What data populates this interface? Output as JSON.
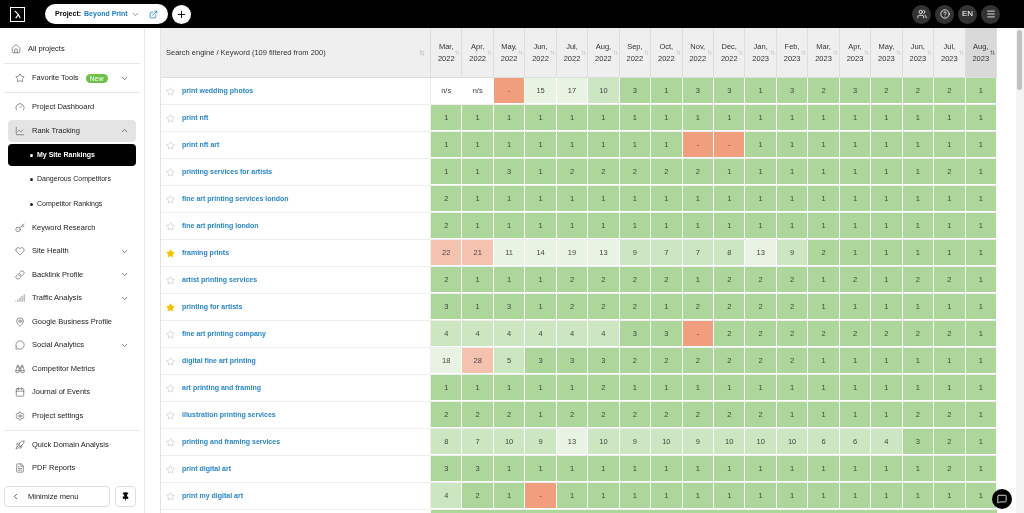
{
  "top_bar": {
    "project_label": "Project:",
    "project_name": "Beyond Print",
    "language": "EN"
  },
  "sidebar": {
    "groups": [
      [
        {
          "label": "All projects",
          "selected": false
        }
      ],
      [
        {
          "label": "Favorite Tools",
          "badge": "New",
          "expanded": false,
          "selected": false
        }
      ],
      [
        {
          "label": "Project Dashboard",
          "selected": false
        },
        {
          "label": "Rank Tracking",
          "expanded": true,
          "selected": true,
          "children": [
            {
              "label": "My Site Rankings",
              "selected": true
            },
            {
              "label": "Dangerous Competitors",
              "selected": false
            },
            {
              "label": "Competitor Rankings",
              "selected": false
            }
          ]
        },
        {
          "label": "Keyword Research",
          "selected": false
        },
        {
          "label": "Site Health",
          "expanded": false,
          "selected": false
        },
        {
          "label": "Backlink Profile",
          "expanded": false,
          "selected": false
        },
        {
          "label": "Traffic Analysis",
          "expanded": false,
          "selected": false
        },
        {
          "label": "Google Business Profile",
          "selected": false
        },
        {
          "label": "Social Analytics",
          "expanded": false,
          "selected": false
        },
        {
          "label": "Competitor Metrics",
          "selected": false
        },
        {
          "label": "Journal of Events",
          "selected": false
        },
        {
          "label": "Project settings",
          "selected": false
        }
      ],
      [
        {
          "label": "Quick Domain Analysis",
          "selected": false
        },
        {
          "label": "PDF Reports",
          "selected": false
        }
      ]
    ],
    "minimize": "Minimize menu"
  },
  "table": {
    "keyword_header": "Search engine / Keyword (109 filtered from 200)",
    "columns": [
      {
        "label": "Mar, 2022",
        "sorted": false
      },
      {
        "label": "Apr, 2022",
        "sorted": false
      },
      {
        "label": "May, 2022",
        "sorted": false
      },
      {
        "label": "Jun, 2022",
        "sorted": false
      },
      {
        "label": "Jul, 2022",
        "sorted": false
      },
      {
        "label": "Aug, 2022",
        "sorted": false
      },
      {
        "label": "Sep, 2022",
        "sorted": false
      },
      {
        "label": "Oct, 2022",
        "sorted": false
      },
      {
        "label": "Nov, 2022",
        "sorted": false
      },
      {
        "label": "Dec, 2022",
        "sorted": false
      },
      {
        "label": "Jan, 2023",
        "sorted": false
      },
      {
        "label": "Feb, 2023",
        "sorted": false
      },
      {
        "label": "Mar, 2023",
        "sorted": false
      },
      {
        "label": "Apr, 2023",
        "sorted": false
      },
      {
        "label": "May, 2023",
        "sorted": false
      },
      {
        "label": "Jun, 2023",
        "sorted": false
      },
      {
        "label": "Jul, 2023",
        "sorted": false
      },
      {
        "label": "Aug, 2023",
        "sorted": true
      }
    ],
    "rows": [
      {
        "keyword": "print wedding photos",
        "starred": false,
        "cells": [
          {
            "text": "n/s",
            "color": "#ffffff"
          },
          {
            "text": "n/s",
            "color": "#ffffff"
          },
          {
            "text": "-",
            "color": "#f19e7f"
          },
          {
            "text": "15",
            "color": "#e9f3e3"
          },
          {
            "text": "17",
            "color": "#e9f3e3"
          },
          {
            "text": "10",
            "color": "#cde6c2"
          },
          {
            "text": "3",
            "color": "#acd69a"
          },
          {
            "text": "1",
            "color": "#acd69a"
          },
          {
            "text": "3",
            "color": "#acd69a"
          },
          {
            "text": "3",
            "color": "#acd69a"
          },
          {
            "text": "1",
            "color": "#acd69a"
          },
          {
            "text": "3",
            "color": "#acd69a"
          },
          {
            "text": "2",
            "color": "#acd69a"
          },
          {
            "text": "3",
            "color": "#acd69a"
          },
          {
            "text": "2",
            "color": "#acd69a"
          },
          {
            "text": "2",
            "color": "#acd69a"
          },
          {
            "text": "2",
            "color": "#acd69a"
          },
          {
            "text": "1",
            "color": "#acd69a"
          }
        ]
      },
      {
        "keyword": "print nft",
        "starred": false,
        "cells": [
          {
            "text": "1",
            "color": "#acd69a"
          },
          {
            "text": "1",
            "color": "#acd69a"
          },
          {
            "text": "1",
            "color": "#acd69a"
          },
          {
            "text": "1",
            "color": "#acd69a"
          },
          {
            "text": "1",
            "color": "#acd69a"
          },
          {
            "text": "1",
            "color": "#acd69a"
          },
          {
            "text": "1",
            "color": "#acd69a"
          },
          {
            "text": "1",
            "color": "#acd69a"
          },
          {
            "text": "1",
            "color": "#acd69a"
          },
          {
            "text": "1",
            "color": "#acd69a"
          },
          {
            "text": "1",
            "color": "#acd69a"
          },
          {
            "text": "1",
            "color": "#acd69a"
          },
          {
            "text": "1",
            "color": "#acd69a"
          },
          {
            "text": "1",
            "color": "#acd69a"
          },
          {
            "text": "1",
            "color": "#acd69a"
          },
          {
            "text": "1",
            "color": "#acd69a"
          },
          {
            "text": "1",
            "color": "#acd69a"
          },
          {
            "text": "1",
            "color": "#acd69a"
          }
        ]
      },
      {
        "keyword": "print nft art",
        "starred": false,
        "cells": [
          {
            "text": "1",
            "color": "#acd69a"
          },
          {
            "text": "1",
            "color": "#acd69a"
          },
          {
            "text": "1",
            "color": "#acd69a"
          },
          {
            "text": "1",
            "color": "#acd69a"
          },
          {
            "text": "1",
            "color": "#acd69a"
          },
          {
            "text": "1",
            "color": "#acd69a"
          },
          {
            "text": "1",
            "color": "#acd69a"
          },
          {
            "text": "1",
            "color": "#acd69a"
          },
          {
            "text": "-",
            "color": "#f19e7f"
          },
          {
            "text": "-",
            "color": "#f19e7f"
          },
          {
            "text": "1",
            "color": "#acd69a"
          },
          {
            "text": "1",
            "color": "#acd69a"
          },
          {
            "text": "1",
            "color": "#acd69a"
          },
          {
            "text": "1",
            "color": "#acd69a"
          },
          {
            "text": "1",
            "color": "#acd69a"
          },
          {
            "text": "1",
            "color": "#acd69a"
          },
          {
            "text": "1",
            "color": "#acd69a"
          },
          {
            "text": "1",
            "color": "#acd69a"
          }
        ]
      },
      {
        "keyword": "printing services for artists",
        "starred": false,
        "cells": [
          {
            "text": "1",
            "color": "#acd69a"
          },
          {
            "text": "1",
            "color": "#acd69a"
          },
          {
            "text": "3",
            "color": "#acd69a"
          },
          {
            "text": "1",
            "color": "#acd69a"
          },
          {
            "text": "2",
            "color": "#acd69a"
          },
          {
            "text": "2",
            "color": "#acd69a"
          },
          {
            "text": "2",
            "color": "#acd69a"
          },
          {
            "text": "2",
            "color": "#acd69a"
          },
          {
            "text": "2",
            "color": "#acd69a"
          },
          {
            "text": "1",
            "color": "#acd69a"
          },
          {
            "text": "1",
            "color": "#acd69a"
          },
          {
            "text": "1",
            "color": "#acd69a"
          },
          {
            "text": "1",
            "color": "#acd69a"
          },
          {
            "text": "1",
            "color": "#acd69a"
          },
          {
            "text": "1",
            "color": "#acd69a"
          },
          {
            "text": "1",
            "color": "#acd69a"
          },
          {
            "text": "2",
            "color": "#acd69a"
          },
          {
            "text": "1",
            "color": "#acd69a"
          }
        ]
      },
      {
        "keyword": "fine art printing services london",
        "starred": false,
        "cells": [
          {
            "text": "2",
            "color": "#acd69a"
          },
          {
            "text": "1",
            "color": "#acd69a"
          },
          {
            "text": "1",
            "color": "#acd69a"
          },
          {
            "text": "1",
            "color": "#acd69a"
          },
          {
            "text": "1",
            "color": "#acd69a"
          },
          {
            "text": "1",
            "color": "#acd69a"
          },
          {
            "text": "1",
            "color": "#acd69a"
          },
          {
            "text": "1",
            "color": "#acd69a"
          },
          {
            "text": "1",
            "color": "#acd69a"
          },
          {
            "text": "1",
            "color": "#acd69a"
          },
          {
            "text": "1",
            "color": "#acd69a"
          },
          {
            "text": "1",
            "color": "#acd69a"
          },
          {
            "text": "1",
            "color": "#acd69a"
          },
          {
            "text": "1",
            "color": "#acd69a"
          },
          {
            "text": "1",
            "color": "#acd69a"
          },
          {
            "text": "1",
            "color": "#acd69a"
          },
          {
            "text": "1",
            "color": "#acd69a"
          },
          {
            "text": "1",
            "color": "#acd69a"
          }
        ]
      },
      {
        "keyword": "fine art printing london",
        "starred": false,
        "cells": [
          {
            "text": "2",
            "color": "#acd69a"
          },
          {
            "text": "1",
            "color": "#acd69a"
          },
          {
            "text": "1",
            "color": "#acd69a"
          },
          {
            "text": "1",
            "color": "#acd69a"
          },
          {
            "text": "1",
            "color": "#acd69a"
          },
          {
            "text": "1",
            "color": "#acd69a"
          },
          {
            "text": "1",
            "color": "#acd69a"
          },
          {
            "text": "1",
            "color": "#acd69a"
          },
          {
            "text": "1",
            "color": "#acd69a"
          },
          {
            "text": "1",
            "color": "#acd69a"
          },
          {
            "text": "1",
            "color": "#acd69a"
          },
          {
            "text": "1",
            "color": "#acd69a"
          },
          {
            "text": "1",
            "color": "#acd69a"
          },
          {
            "text": "1",
            "color": "#acd69a"
          },
          {
            "text": "1",
            "color": "#acd69a"
          },
          {
            "text": "1",
            "color": "#acd69a"
          },
          {
            "text": "1",
            "color": "#acd69a"
          },
          {
            "text": "1",
            "color": "#acd69a"
          }
        ]
      },
      {
        "keyword": "framing prints",
        "starred": true,
        "cells": [
          {
            "text": "22",
            "color": "#f4c2ae"
          },
          {
            "text": "21",
            "color": "#f4c2ae"
          },
          {
            "text": "11",
            "color": "#e9f3e3"
          },
          {
            "text": "14",
            "color": "#e9f3e3"
          },
          {
            "text": "19",
            "color": "#e9f3e3"
          },
          {
            "text": "13",
            "color": "#e9f3e3"
          },
          {
            "text": "9",
            "color": "#cde6c2"
          },
          {
            "text": "7",
            "color": "#cde6c2"
          },
          {
            "text": "7",
            "color": "#cde6c2"
          },
          {
            "text": "8",
            "color": "#cde6c2"
          },
          {
            "text": "13",
            "color": "#e9f3e3"
          },
          {
            "text": "9",
            "color": "#cde6c2"
          },
          {
            "text": "2",
            "color": "#acd69a"
          },
          {
            "text": "1",
            "color": "#acd69a"
          },
          {
            "text": "1",
            "color": "#acd69a"
          },
          {
            "text": "1",
            "color": "#acd69a"
          },
          {
            "text": "1",
            "color": "#acd69a"
          },
          {
            "text": "1",
            "color": "#acd69a"
          }
        ]
      },
      {
        "keyword": "artist printing services",
        "starred": false,
        "cells": [
          {
            "text": "2",
            "color": "#acd69a"
          },
          {
            "text": "1",
            "color": "#acd69a"
          },
          {
            "text": "1",
            "color": "#acd69a"
          },
          {
            "text": "1",
            "color": "#acd69a"
          },
          {
            "text": "2",
            "color": "#acd69a"
          },
          {
            "text": "2",
            "color": "#acd69a"
          },
          {
            "text": "2",
            "color": "#acd69a"
          },
          {
            "text": "2",
            "color": "#acd69a"
          },
          {
            "text": "1",
            "color": "#acd69a"
          },
          {
            "text": "2",
            "color": "#acd69a"
          },
          {
            "text": "2",
            "color": "#acd69a"
          },
          {
            "text": "2",
            "color": "#acd69a"
          },
          {
            "text": "1",
            "color": "#acd69a"
          },
          {
            "text": "2",
            "color": "#acd69a"
          },
          {
            "text": "1",
            "color": "#acd69a"
          },
          {
            "text": "2",
            "color": "#acd69a"
          },
          {
            "text": "2",
            "color": "#acd69a"
          },
          {
            "text": "1",
            "color": "#acd69a"
          }
        ]
      },
      {
        "keyword": "printing for artists",
        "starred": true,
        "cells": [
          {
            "text": "3",
            "color": "#acd69a"
          },
          {
            "text": "1",
            "color": "#acd69a"
          },
          {
            "text": "3",
            "color": "#acd69a"
          },
          {
            "text": "1",
            "color": "#acd69a"
          },
          {
            "text": "2",
            "color": "#acd69a"
          },
          {
            "text": "2",
            "color": "#acd69a"
          },
          {
            "text": "2",
            "color": "#acd69a"
          },
          {
            "text": "1",
            "color": "#acd69a"
          },
          {
            "text": "2",
            "color": "#acd69a"
          },
          {
            "text": "2",
            "color": "#acd69a"
          },
          {
            "text": "2",
            "color": "#acd69a"
          },
          {
            "text": "2",
            "color": "#acd69a"
          },
          {
            "text": "1",
            "color": "#acd69a"
          },
          {
            "text": "1",
            "color": "#acd69a"
          },
          {
            "text": "1",
            "color": "#acd69a"
          },
          {
            "text": "1",
            "color": "#acd69a"
          },
          {
            "text": "1",
            "color": "#acd69a"
          },
          {
            "text": "1",
            "color": "#acd69a"
          }
        ]
      },
      {
        "keyword": "fine art printing company",
        "starred": false,
        "cells": [
          {
            "text": "4",
            "color": "#cde6c2"
          },
          {
            "text": "4",
            "color": "#cde6c2"
          },
          {
            "text": "4",
            "color": "#cde6c2"
          },
          {
            "text": "4",
            "color": "#cde6c2"
          },
          {
            "text": "4",
            "color": "#cde6c2"
          },
          {
            "text": "4",
            "color": "#cde6c2"
          },
          {
            "text": "3",
            "color": "#acd69a"
          },
          {
            "text": "3",
            "color": "#acd69a"
          },
          {
            "text": "-",
            "color": "#f19e7f"
          },
          {
            "text": "2",
            "color": "#acd69a"
          },
          {
            "text": "2",
            "color": "#acd69a"
          },
          {
            "text": "2",
            "color": "#acd69a"
          },
          {
            "text": "2",
            "color": "#acd69a"
          },
          {
            "text": "2",
            "color": "#acd69a"
          },
          {
            "text": "2",
            "color": "#acd69a"
          },
          {
            "text": "2",
            "color": "#acd69a"
          },
          {
            "text": "2",
            "color": "#acd69a"
          },
          {
            "text": "1",
            "color": "#acd69a"
          }
        ]
      },
      {
        "keyword": "digital fine art printing",
        "starred": false,
        "cells": [
          {
            "text": "18",
            "color": "#e9f3e3"
          },
          {
            "text": "28",
            "color": "#f4c2ae"
          },
          {
            "text": "5",
            "color": "#cde6c2"
          },
          {
            "text": "3",
            "color": "#acd69a"
          },
          {
            "text": "3",
            "color": "#acd69a"
          },
          {
            "text": "3",
            "color": "#acd69a"
          },
          {
            "text": "2",
            "color": "#acd69a"
          },
          {
            "text": "2",
            "color": "#acd69a"
          },
          {
            "text": "2",
            "color": "#acd69a"
          },
          {
            "text": "2",
            "color": "#acd69a"
          },
          {
            "text": "2",
            "color": "#acd69a"
          },
          {
            "text": "2",
            "color": "#acd69a"
          },
          {
            "text": "1",
            "color": "#acd69a"
          },
          {
            "text": "1",
            "color": "#acd69a"
          },
          {
            "text": "1",
            "color": "#acd69a"
          },
          {
            "text": "1",
            "color": "#acd69a"
          },
          {
            "text": "1",
            "color": "#acd69a"
          },
          {
            "text": "1",
            "color": "#acd69a"
          }
        ]
      },
      {
        "keyword": "art printing and framing",
        "starred": false,
        "cells": [
          {
            "text": "1",
            "color": "#acd69a"
          },
          {
            "text": "1",
            "color": "#acd69a"
          },
          {
            "text": "1",
            "color": "#acd69a"
          },
          {
            "text": "1",
            "color": "#acd69a"
          },
          {
            "text": "1",
            "color": "#acd69a"
          },
          {
            "text": "2",
            "color": "#acd69a"
          },
          {
            "text": "1",
            "color": "#acd69a"
          },
          {
            "text": "1",
            "color": "#acd69a"
          },
          {
            "text": "1",
            "color": "#acd69a"
          },
          {
            "text": "1",
            "color": "#acd69a"
          },
          {
            "text": "1",
            "color": "#acd69a"
          },
          {
            "text": "1",
            "color": "#acd69a"
          },
          {
            "text": "1",
            "color": "#acd69a"
          },
          {
            "text": "1",
            "color": "#acd69a"
          },
          {
            "text": "1",
            "color": "#acd69a"
          },
          {
            "text": "1",
            "color": "#acd69a"
          },
          {
            "text": "1",
            "color": "#acd69a"
          },
          {
            "text": "1",
            "color": "#acd69a"
          }
        ]
      },
      {
        "keyword": "illustration printing services",
        "starred": false,
        "cells": [
          {
            "text": "2",
            "color": "#acd69a"
          },
          {
            "text": "2",
            "color": "#acd69a"
          },
          {
            "text": "2",
            "color": "#acd69a"
          },
          {
            "text": "1",
            "color": "#acd69a"
          },
          {
            "text": "2",
            "color": "#acd69a"
          },
          {
            "text": "2",
            "color": "#acd69a"
          },
          {
            "text": "2",
            "color": "#acd69a"
          },
          {
            "text": "2",
            "color": "#acd69a"
          },
          {
            "text": "2",
            "color": "#acd69a"
          },
          {
            "text": "2",
            "color": "#acd69a"
          },
          {
            "text": "2",
            "color": "#acd69a"
          },
          {
            "text": "1",
            "color": "#acd69a"
          },
          {
            "text": "1",
            "color": "#acd69a"
          },
          {
            "text": "1",
            "color": "#acd69a"
          },
          {
            "text": "1",
            "color": "#acd69a"
          },
          {
            "text": "2",
            "color": "#acd69a"
          },
          {
            "text": "2",
            "color": "#acd69a"
          },
          {
            "text": "1",
            "color": "#acd69a"
          }
        ]
      },
      {
        "keyword": "printing and framing services",
        "starred": false,
        "cells": [
          {
            "text": "8",
            "color": "#cde6c2"
          },
          {
            "text": "7",
            "color": "#cde6c2"
          },
          {
            "text": "10",
            "color": "#cde6c2"
          },
          {
            "text": "9",
            "color": "#cde6c2"
          },
          {
            "text": "13",
            "color": "#e9f3e3"
          },
          {
            "text": "10",
            "color": "#cde6c2"
          },
          {
            "text": "9",
            "color": "#cde6c2"
          },
          {
            "text": "10",
            "color": "#cde6c2"
          },
          {
            "text": "9",
            "color": "#cde6c2"
          },
          {
            "text": "10",
            "color": "#cde6c2"
          },
          {
            "text": "10",
            "color": "#cde6c2"
          },
          {
            "text": "10",
            "color": "#cde6c2"
          },
          {
            "text": "6",
            "color": "#cde6c2"
          },
          {
            "text": "6",
            "color": "#cde6c2"
          },
          {
            "text": "4",
            "color": "#cde6c2"
          },
          {
            "text": "3",
            "color": "#acd69a"
          },
          {
            "text": "2",
            "color": "#acd69a"
          },
          {
            "text": "1",
            "color": "#acd69a"
          }
        ]
      },
      {
        "keyword": "print digital art",
        "starred": false,
        "cells": [
          {
            "text": "3",
            "color": "#acd69a"
          },
          {
            "text": "3",
            "color": "#acd69a"
          },
          {
            "text": "1",
            "color": "#acd69a"
          },
          {
            "text": "1",
            "color": "#acd69a"
          },
          {
            "text": "1",
            "color": "#acd69a"
          },
          {
            "text": "1",
            "color": "#acd69a"
          },
          {
            "text": "1",
            "color": "#acd69a"
          },
          {
            "text": "1",
            "color": "#acd69a"
          },
          {
            "text": "1",
            "color": "#acd69a"
          },
          {
            "text": "1",
            "color": "#acd69a"
          },
          {
            "text": "1",
            "color": "#acd69a"
          },
          {
            "text": "1",
            "color": "#acd69a"
          },
          {
            "text": "1",
            "color": "#acd69a"
          },
          {
            "text": "1",
            "color": "#acd69a"
          },
          {
            "text": "1",
            "color": "#acd69a"
          },
          {
            "text": "1",
            "color": "#acd69a"
          },
          {
            "text": "2",
            "color": "#acd69a"
          },
          {
            "text": "1",
            "color": "#acd69a"
          }
        ]
      },
      {
        "keyword": "print my digital art",
        "starred": false,
        "cells": [
          {
            "text": "4",
            "color": "#cde6c2"
          },
          {
            "text": "2",
            "color": "#acd69a"
          },
          {
            "text": "1",
            "color": "#acd69a"
          },
          {
            "text": "-",
            "color": "#f19e7f"
          },
          {
            "text": "1",
            "color": "#acd69a"
          },
          {
            "text": "1",
            "color": "#acd69a"
          },
          {
            "text": "1",
            "color": "#acd69a"
          },
          {
            "text": "1",
            "color": "#acd69a"
          },
          {
            "text": "1",
            "color": "#acd69a"
          },
          {
            "text": "1",
            "color": "#acd69a"
          },
          {
            "text": "1",
            "color": "#acd69a"
          },
          {
            "text": "1",
            "color": "#acd69a"
          },
          {
            "text": "1",
            "color": "#acd69a"
          },
          {
            "text": "1",
            "color": "#acd69a"
          },
          {
            "text": "1",
            "color": "#acd69a"
          },
          {
            "text": "1",
            "color": "#acd69a"
          },
          {
            "text": "1",
            "color": "#acd69a"
          },
          {
            "text": "1",
            "color": "#acd69a"
          }
        ]
      }
    ]
  }
}
